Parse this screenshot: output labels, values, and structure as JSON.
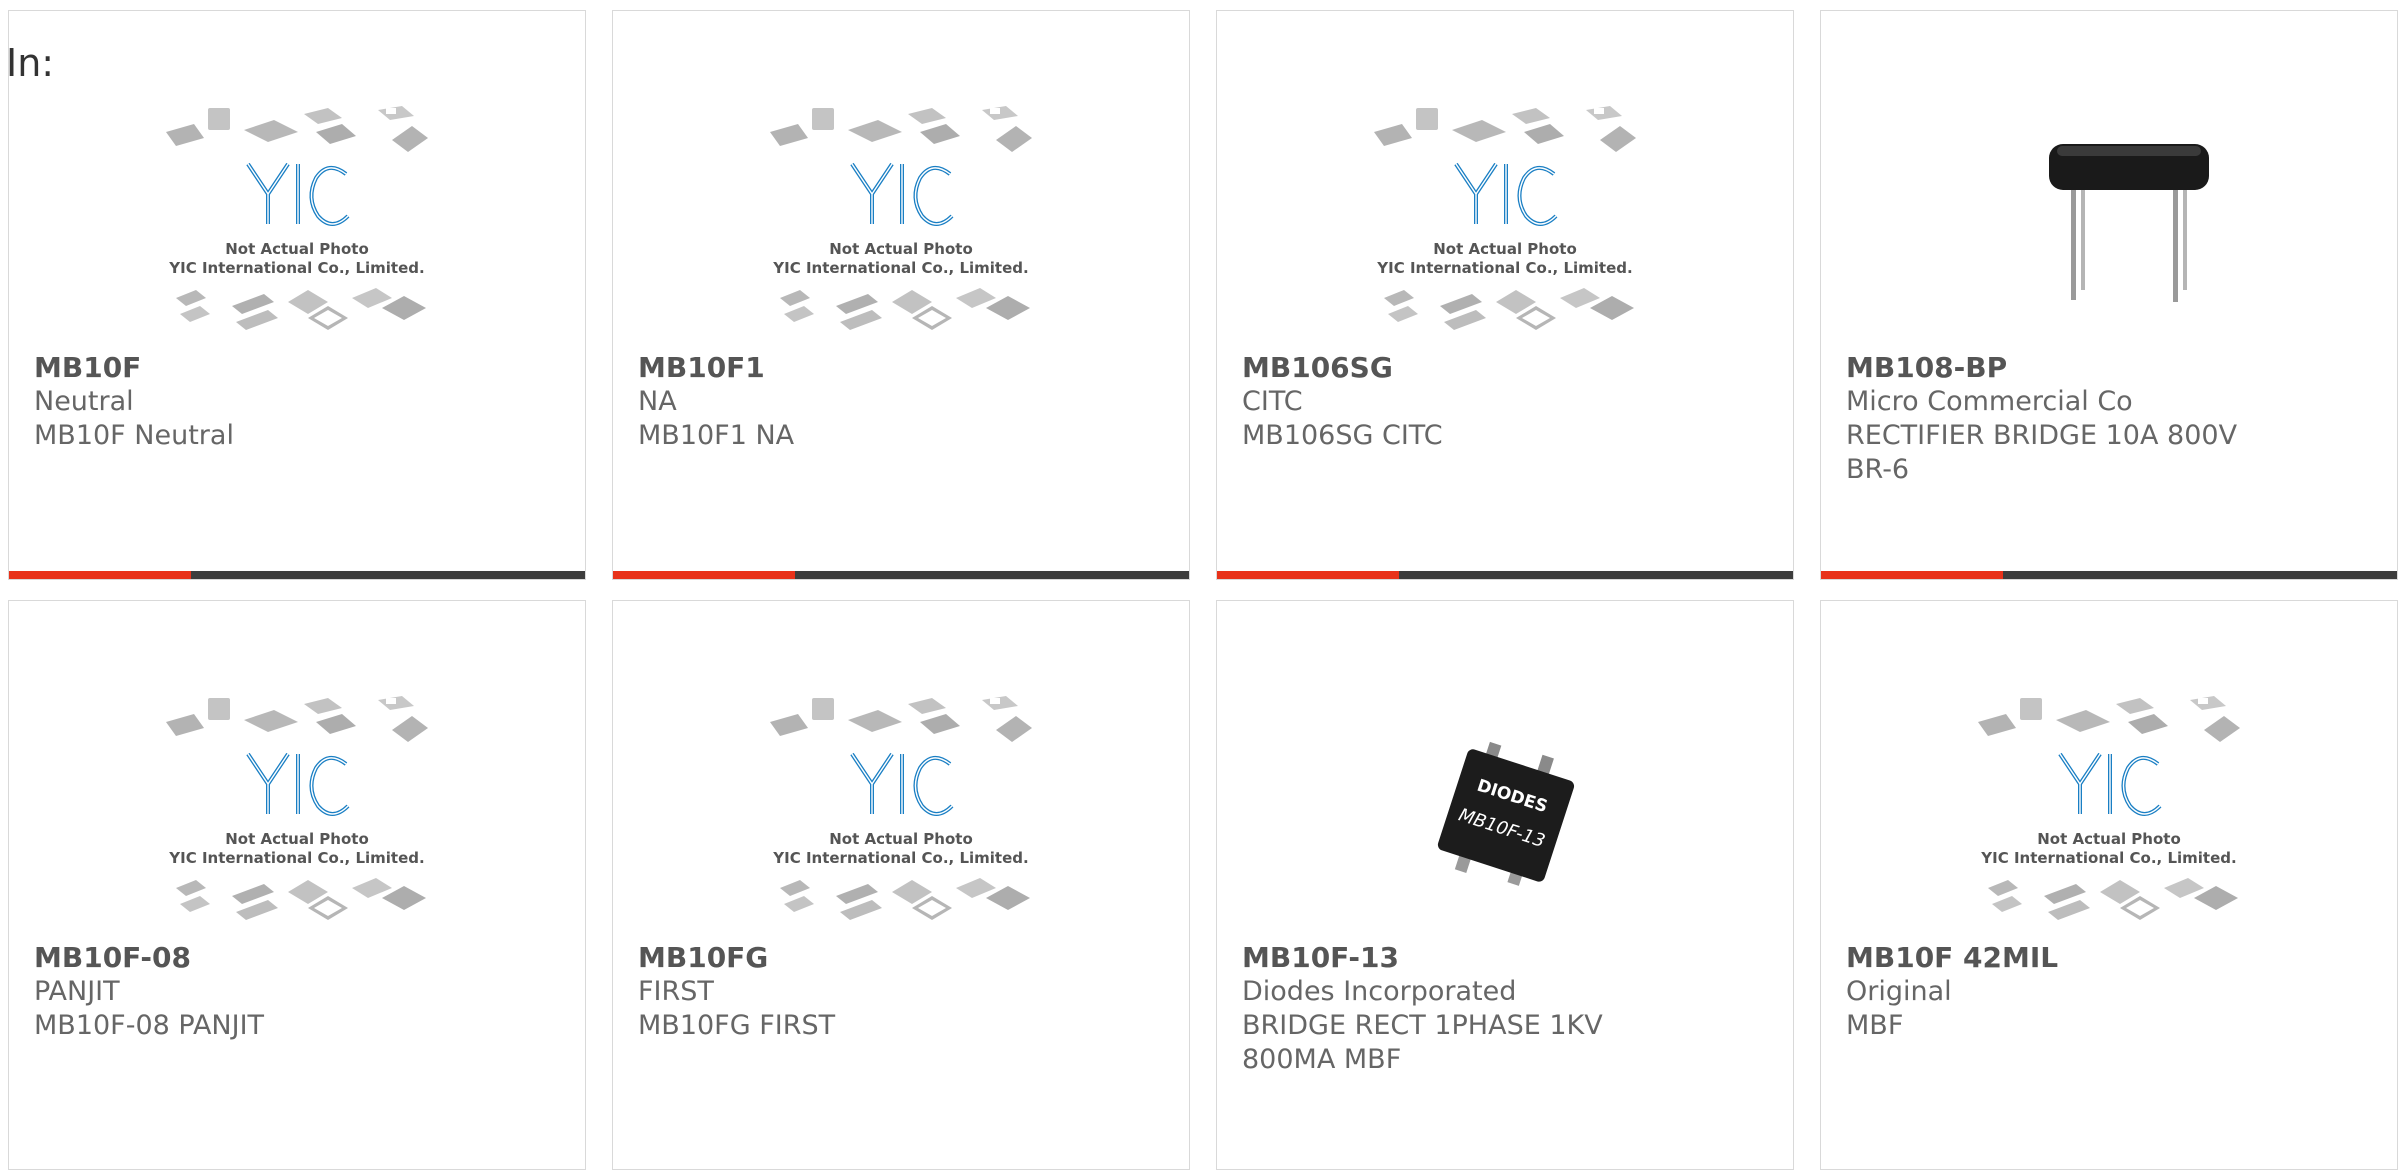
{
  "filter_label": "In:",
  "placeholder_image": {
    "line1": "Not Actual Photo",
    "line2": "YIC International Co., Limited."
  },
  "products": [
    {
      "part": "MB10F",
      "maker": "Neutral",
      "description": "MB10F Neutral",
      "image": "placeholder"
    },
    {
      "part": "MB10F1",
      "maker": "NA",
      "description": "MB10F1 NA",
      "image": "placeholder"
    },
    {
      "part": "MB106SG",
      "maker": "CITC",
      "description": "MB106SG CITC",
      "image": "placeholder"
    },
    {
      "part": "MB108-BP",
      "maker": "Micro Commercial Co",
      "description": "RECTIFIER BRIDGE 10A 800V BR-6",
      "image": "bridge-rectifier-photo"
    },
    {
      "part": "MB10F-08",
      "maker": "PANJIT",
      "description": "MB10F-08 PANJIT",
      "image": "placeholder"
    },
    {
      "part": "MB10FG",
      "maker": "FIRST",
      "description": "MB10FG FIRST",
      "image": "placeholder"
    },
    {
      "part": "MB10F-13",
      "maker": "Diodes Incorporated",
      "description": "BRIDGE RECT 1PHASE 1KV 800MA MBF",
      "image": "diodes-chip-photo"
    },
    {
      "part": "MB10F 42MIL",
      "maker": "Original",
      "description": "MBF",
      "image": "placeholder"
    }
  ],
  "chip_photo_text": {
    "brand": "DIODES",
    "marking": "MB10F-13"
  },
  "colors": {
    "accent_red": "#e8321a",
    "bar_dark": "#3d3d3d",
    "logo_blue": "#1a7fc4",
    "chip_gray": "#b0b0b0"
  }
}
